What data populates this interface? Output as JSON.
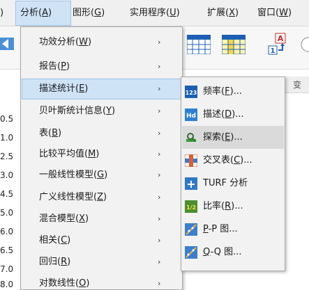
{
  "menubar": {
    "items": [
      {
        "label": "分析(",
        "key": "A",
        "suffix": ")"
      },
      {
        "label": "图形(",
        "key": "G",
        "suffix": ")"
      },
      {
        "label": "实用程序(",
        "key": "U",
        "suffix": ")"
      },
      {
        "label": "扩展(",
        "key": "X",
        "suffix": ")"
      },
      {
        "label": "窗口(",
        "key": "W",
        "suffix": ")"
      }
    ]
  },
  "background": {
    "row_numbers": [
      "0.5",
      "1.0",
      "2.5",
      "3.0",
      "4.5",
      "5.0",
      "6.0",
      "6.5",
      "7.0",
      "8.0"
    ],
    "column_header": "变"
  },
  "analyze_menu": {
    "items": [
      {
        "label": "功效分析(",
        "key": "W",
        "suffix": ")"
      },
      {
        "label": "报告(",
        "key": "P",
        "suffix": ")"
      },
      {
        "label": "描述统计(",
        "key": "E",
        "suffix": ")"
      },
      {
        "label": "贝叶斯统计信息(",
        "key": "Y",
        "suffix": ")"
      },
      {
        "label": "表(",
        "key": "B",
        "suffix": ")"
      },
      {
        "label": "比较平均值(",
        "key": "M",
        "suffix": ")"
      },
      {
        "label": "一般线性模型(",
        "key": "G",
        "suffix": ")"
      },
      {
        "label": "广义线性模型(",
        "key": "Z",
        "suffix": ")"
      },
      {
        "label": "混合模型(",
        "key": "X",
        "suffix": ")"
      },
      {
        "label": "相关(",
        "key": "C",
        "suffix": ")"
      },
      {
        "label": "回归(",
        "key": "R",
        "suffix": ")"
      },
      {
        "label": "对数线性(",
        "key": "O",
        "suffix": ")"
      }
    ],
    "arrow": "›"
  },
  "descriptives_submenu": {
    "items": [
      {
        "label": "频率(",
        "key": "F",
        "suffix": ")...",
        "icon": "frequencies-icon",
        "icon_text": "123"
      },
      {
        "label": "描述(",
        "key": "D",
        "suffix": ")...",
        "icon": "descriptives-icon",
        "icon_text": "Hd"
      },
      {
        "label": "探索(",
        "key": "E",
        "suffix": ")...",
        "icon": "explore-icon",
        "icon_text": ""
      },
      {
        "label": "交叉表(",
        "key": "C",
        "suffix": ")...",
        "icon": "crosstabs-icon",
        "icon_text": ""
      },
      {
        "label": "TURF 分析",
        "key": "",
        "suffix": "",
        "icon": "turf-icon",
        "icon_text": "+"
      },
      {
        "label": "比率(",
        "key": "R",
        "suffix": ")...",
        "icon": "ratio-icon",
        "icon_text": "1/2"
      },
      {
        "label": "",
        "key": "P",
        "suffix": "-P 图...",
        "icon": "pp-plot-icon",
        "icon_text": ""
      },
      {
        "label": "",
        "key": "Q",
        "suffix": "-Q 图...",
        "icon": "qq-plot-icon",
        "icon_text": ""
      }
    ]
  },
  "colors": {
    "menu_bg": "#f2f2f2",
    "highlight": "#cfe3f7",
    "highlight_border": "#9ec3e6",
    "hover_gray": "#dadada"
  }
}
